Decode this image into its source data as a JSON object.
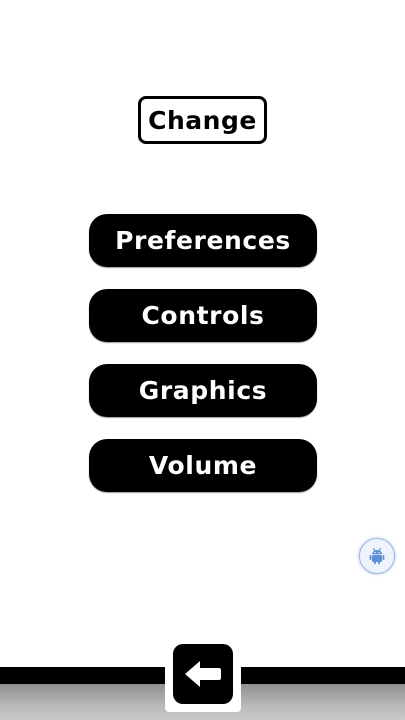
{
  "screen": {
    "title": "Change"
  },
  "menu": {
    "items": [
      {
        "label": "Preferences"
      },
      {
        "label": "Controls"
      },
      {
        "label": "Graphics"
      },
      {
        "label": "Volume"
      }
    ]
  },
  "floating_button": {
    "icon": "android-icon",
    "color": "#5b8fd6"
  },
  "navigation": {
    "back_icon": "arrow-left-icon"
  },
  "colors": {
    "background": "#ffffff",
    "button_fill": "#000000",
    "button_text": "#ffffff"
  }
}
